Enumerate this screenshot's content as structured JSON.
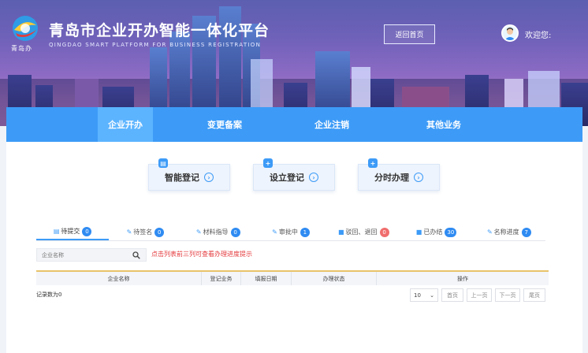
{
  "header": {
    "title": "青岛市企业开办智能一体化平台",
    "subtitle": "QINGDAO SMART PLATFORM FOR BUSINESS REGISTRATION",
    "logo_text": "青岛办",
    "home_button": "返回首页",
    "welcome": "欢迎您:"
  },
  "nav": {
    "items": [
      "企业开办",
      "变更备案",
      "企业注销",
      "其他业务"
    ],
    "active": 0
  },
  "actions": [
    {
      "label": "智能登记",
      "icon": "smart-register-icon"
    },
    {
      "label": "设立登记",
      "icon": "establish-register-icon"
    },
    {
      "label": "分时办理",
      "icon": "timeshare-icon"
    }
  ],
  "tabs": [
    {
      "label": "待提交",
      "count": "0"
    },
    {
      "label": "待签名",
      "count": "0"
    },
    {
      "label": "材料指导",
      "count": "0"
    },
    {
      "label": "审批中",
      "count": "1"
    },
    {
      "label": "驳回、退回",
      "count": "0"
    },
    {
      "label": "已办结",
      "count": "30"
    },
    {
      "label": "名称进度",
      "count": "7"
    }
  ],
  "search": {
    "placeholder": "企业名称"
  },
  "hint": "点击列表前三列可查看办理进度提示",
  "table": {
    "columns": [
      "企业名称",
      "登记业务",
      "填报日期",
      "办理状态",
      "操作"
    ]
  },
  "record_count": "记录数为0",
  "pager": {
    "page_size": "10",
    "first": "首页",
    "prev": "上一页",
    "next": "下一页",
    "last": "尾页"
  },
  "colors": {
    "accent": "#3d9bf7",
    "accent_light": "#5cb4ff",
    "alert": "#e4393c"
  }
}
